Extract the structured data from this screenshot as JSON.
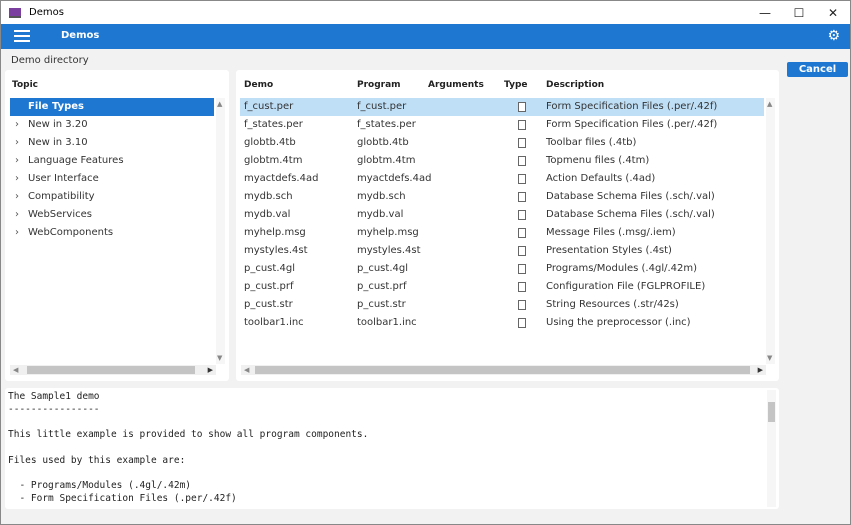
{
  "window": {
    "title": "Demos",
    "minimize": "—",
    "maximize": "☐",
    "close": "✕"
  },
  "header": {
    "title": "Demos",
    "menu_icon": "hamburger-icon",
    "settings_icon": "gear-icon",
    "accent": "#1e78d2"
  },
  "page": {
    "label": "Demo directory",
    "cancel_label": "Cancel"
  },
  "topics": {
    "header": "Topic",
    "items": [
      {
        "label": "File Types",
        "selected": true
      },
      {
        "label": "New in 3.20"
      },
      {
        "label": "New in 3.10"
      },
      {
        "label": "Language Features"
      },
      {
        "label": "User Interface"
      },
      {
        "label": "Compatibility"
      },
      {
        "label": "WebServices"
      },
      {
        "label": "WebComponents"
      }
    ]
  },
  "demos": {
    "columns": [
      "Demo",
      "Program",
      "Arguments",
      "Type",
      "Description"
    ],
    "rows": [
      {
        "demo": "f_cust.per",
        "program": "f_cust.per",
        "args": "",
        "description": "Form Specification Files (.per/.42f)",
        "selected": true
      },
      {
        "demo": "f_states.per",
        "program": "f_states.per",
        "args": "",
        "description": "Form Specification Files (.per/.42f)"
      },
      {
        "demo": "globtb.4tb",
        "program": "globtb.4tb",
        "args": "",
        "description": "Toolbar files (.4tb)"
      },
      {
        "demo": "globtm.4tm",
        "program": "globtm.4tm",
        "args": "",
        "description": "Topmenu files (.4tm)"
      },
      {
        "demo": "myactdefs.4ad",
        "program": "myactdefs.4ad",
        "args": "",
        "description": "Action Defaults (.4ad)"
      },
      {
        "demo": "mydb.sch",
        "program": "mydb.sch",
        "args": "",
        "description": "Database Schema Files (.sch/.val)"
      },
      {
        "demo": "mydb.val",
        "program": "mydb.val",
        "args": "",
        "description": "Database Schema Files (.sch/.val)"
      },
      {
        "demo": "myhelp.msg",
        "program": "myhelp.msg",
        "args": "",
        "description": "Message Files (.msg/.iem)"
      },
      {
        "demo": "mystyles.4st",
        "program": "mystyles.4st",
        "args": "",
        "description": "Presentation Styles (.4st)"
      },
      {
        "demo": "p_cust.4gl",
        "program": "p_cust.4gl",
        "args": "",
        "description": "Programs/Modules (.4gl/.42m)"
      },
      {
        "demo": "p_cust.prf",
        "program": "p_cust.prf",
        "args": "",
        "description": "Configuration File (FGLPROFILE)"
      },
      {
        "demo": "p_cust.str",
        "program": "p_cust.str",
        "args": "",
        "description": "String Resources (.str/42s)"
      },
      {
        "demo": "toolbar1.inc",
        "program": "toolbar1.inc",
        "args": "",
        "description": "Using the preprocessor (.inc)"
      }
    ]
  },
  "description_text": "The Sample1 demo\n----------------\n\nThis little example is provided to show all program components.\n\nFiles used by this example are:\n\n  - Programs/Modules (.4gl/.42m)\n  - Form Specification Files (.per/.42f)"
}
